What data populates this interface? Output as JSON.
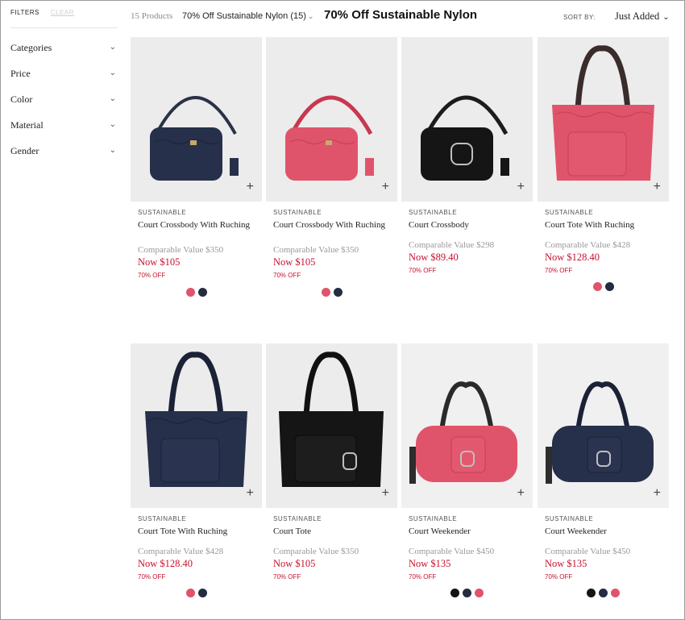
{
  "sidebar": {
    "filters_label": "FILTERS",
    "clear_label": "CLEAR",
    "facets": [
      "Categories",
      "Price",
      "Color",
      "Material",
      "Gender"
    ]
  },
  "header": {
    "count": "15 Products",
    "active_filter": "70% Off Sustainable Nylon (15)",
    "title": "70% Off Sustainable Nylon",
    "sort_label": "SORT BY:",
    "sort_value": "Just Added"
  },
  "colors": {
    "sale": "#c8102e",
    "pink": "#e0546b",
    "navy": "#232c40",
    "black": "#151515"
  },
  "products": [
    {
      "tag": "SUSTAINABLE",
      "name": "Court Crossbody With Ruching",
      "comparable": "Comparable Value $350",
      "now": "Now $105",
      "off": "70% OFF",
      "swatches": [
        "pink",
        "navy"
      ]
    },
    {
      "tag": "SUSTAINABLE",
      "name": "Court Crossbody With Ruching",
      "comparable": "Comparable Value $350",
      "now": "Now $105",
      "off": "70% OFF",
      "swatches": [
        "pink",
        "navy"
      ]
    },
    {
      "tag": "SUSTAINABLE",
      "name": "Court Crossbody",
      "comparable": "Comparable Value $298",
      "now": "Now $89.40",
      "off": "70% OFF",
      "swatches": []
    },
    {
      "tag": "SUSTAINABLE",
      "name": "Court Tote With Ruching",
      "comparable": "Comparable Value $428",
      "now": "Now $128.40",
      "off": "70% OFF",
      "swatches": [
        "pink",
        "navy"
      ]
    },
    {
      "tag": "SUSTAINABLE",
      "name": "Court Tote With Ruching",
      "comparable": "Comparable Value $428",
      "now": "Now $128.40",
      "off": "70% OFF",
      "swatches": [
        "pink",
        "navy"
      ]
    },
    {
      "tag": "SUSTAINABLE",
      "name": "Court Tote",
      "comparable": "Comparable Value $350",
      "now": "Now $105",
      "off": "70% OFF",
      "swatches": []
    },
    {
      "tag": "SUSTAINABLE",
      "name": "Court Weekender",
      "comparable": "Comparable Value $450",
      "now": "Now $135",
      "off": "70% OFF",
      "swatches": [
        "black",
        "navy",
        "pink"
      ]
    },
    {
      "tag": "SUSTAINABLE",
      "name": "Court Weekender",
      "comparable": "Comparable Value $450",
      "now": "Now $135",
      "off": "70% OFF",
      "swatches": [
        "black",
        "navy",
        "pink"
      ]
    }
  ]
}
